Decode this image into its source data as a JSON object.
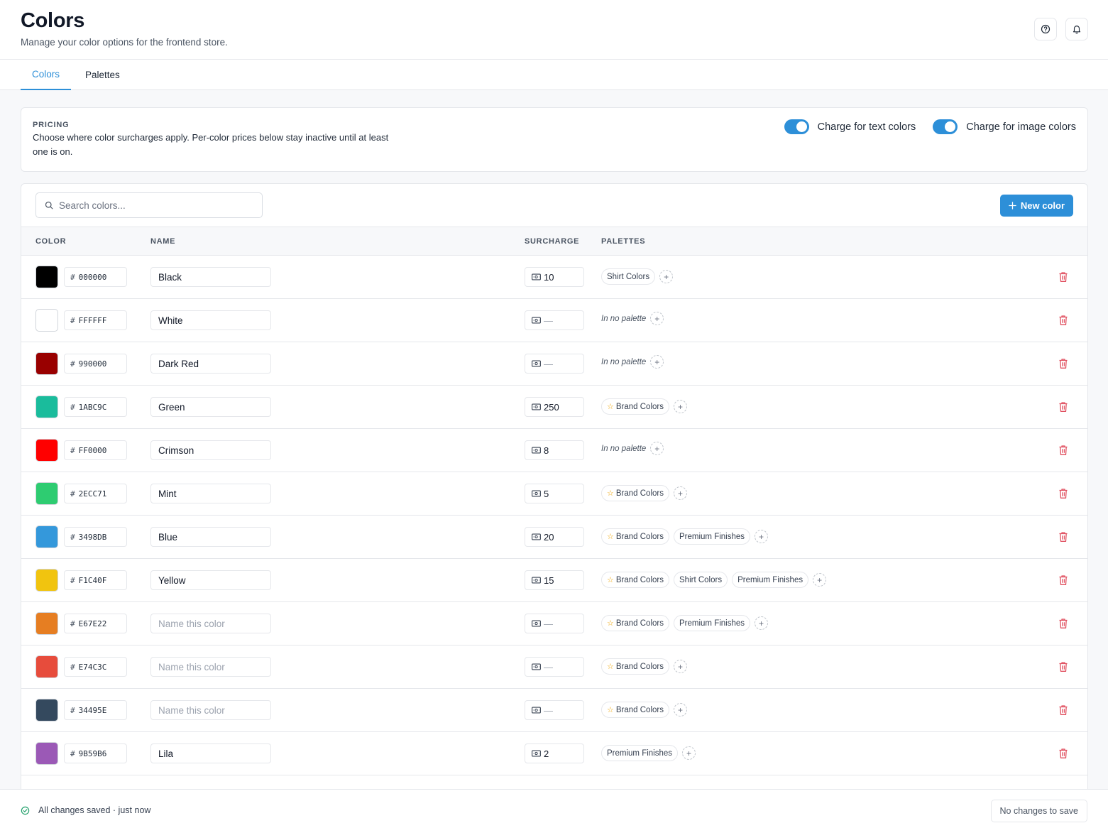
{
  "header": {
    "title": "Colors",
    "subtitle": "Manage your color options for the frontend store."
  },
  "tabs": [
    {
      "label": "Colors",
      "active": true
    },
    {
      "label": "Palettes",
      "active": false
    }
  ],
  "pricing": {
    "label": "PRICING",
    "description": "Choose where color surcharges apply. Per-color prices below stay inactive until at least one is on.",
    "toggles": [
      {
        "label": "Charge for text colors",
        "on": true
      },
      {
        "label": "Charge for image colors",
        "on": true
      }
    ]
  },
  "toolbar": {
    "search_placeholder": "Search colors...",
    "new_button": "New color"
  },
  "table": {
    "columns": [
      "COLOR",
      "NAME",
      "SURCHARGE",
      "PALETTES"
    ],
    "name_placeholder": "Name this color",
    "no_palette_text": "In no palette",
    "empty_surcharge": "—",
    "rows": [
      {
        "color": "#000000",
        "hex": "000000",
        "name": "Black",
        "surcharge": "10",
        "palettes": [
          {
            "name": "Shirt Colors",
            "starred": false
          }
        ]
      },
      {
        "color": "#FFFFFF",
        "hex": "FFFFFF",
        "name": "White",
        "surcharge": "",
        "palettes": []
      },
      {
        "color": "#990000",
        "hex": "990000",
        "name": "Dark Red",
        "surcharge": "",
        "palettes": []
      },
      {
        "color": "#1ABC9C",
        "hex": "1ABC9C",
        "name": "Green",
        "surcharge": "250",
        "palettes": [
          {
            "name": "Brand Colors",
            "starred": true
          }
        ]
      },
      {
        "color": "#FF0000",
        "hex": "FF0000",
        "name": "Crimson",
        "surcharge": "8",
        "palettes": []
      },
      {
        "color": "#2ECC71",
        "hex": "2ECC71",
        "name": "Mint",
        "surcharge": "5",
        "palettes": [
          {
            "name": "Brand Colors",
            "starred": true
          }
        ]
      },
      {
        "color": "#3498DB",
        "hex": "3498DB",
        "name": "Blue",
        "surcharge": "20",
        "palettes": [
          {
            "name": "Brand Colors",
            "starred": true
          },
          {
            "name": "Premium Finishes",
            "starred": false
          }
        ]
      },
      {
        "color": "#F1C40F",
        "hex": "F1C40F",
        "name": "Yellow",
        "surcharge": "15",
        "palettes": [
          {
            "name": "Brand Colors",
            "starred": true
          },
          {
            "name": "Shirt Colors",
            "starred": false
          },
          {
            "name": "Premium Finishes",
            "starred": false
          }
        ]
      },
      {
        "color": "#E67E22",
        "hex": "E67E22",
        "name": "",
        "surcharge": "",
        "palettes": [
          {
            "name": "Brand Colors",
            "starred": true
          },
          {
            "name": "Premium Finishes",
            "starred": false
          }
        ]
      },
      {
        "color": "#E74C3C",
        "hex": "E74C3C",
        "name": "",
        "surcharge": "",
        "palettes": [
          {
            "name": "Brand Colors",
            "starred": true
          }
        ]
      },
      {
        "color": "#34495E",
        "hex": "34495E",
        "name": "",
        "surcharge": "",
        "palettes": [
          {
            "name": "Brand Colors",
            "starred": true
          }
        ]
      },
      {
        "color": "#9B59B6",
        "hex": "9B59B6",
        "name": "Lila",
        "surcharge": "2",
        "palettes": [
          {
            "name": "Premium Finishes",
            "starred": false
          }
        ]
      }
    ]
  },
  "footer": {
    "status": "All changes saved · just now",
    "button": "No changes to save"
  },
  "colors": {
    "accent": "#2D8FD8",
    "success": "#22A06B",
    "danger": "#E04F5F"
  }
}
